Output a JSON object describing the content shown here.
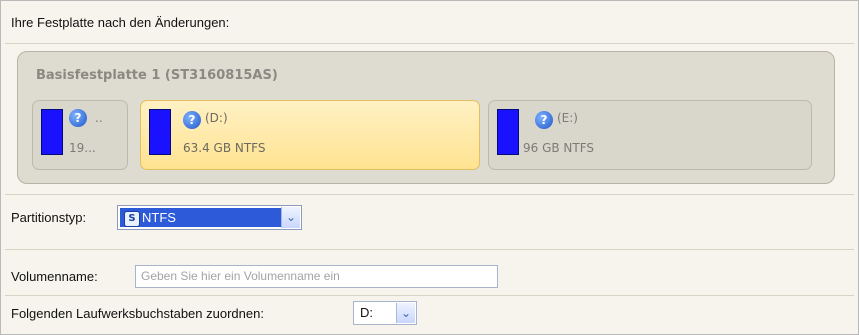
{
  "header": {
    "title": "Ihre Festplatte nach den Änderungen:"
  },
  "disk": {
    "title": "Basisfestplatte 1 (ST3160815AS)",
    "partitions": [
      {
        "name": "..",
        "size": "19...",
        "selected": false
      },
      {
        "name": "(D:)",
        "size": "63.4 GB NTFS",
        "selected": true
      },
      {
        "name": "(E:)",
        "size": "96 GB NTFS",
        "selected": false
      }
    ]
  },
  "form": {
    "partition_type": {
      "label": "Partitionstyp:",
      "value": "NTFS"
    },
    "volume_name": {
      "label": "Volumenname:",
      "placeholder": "Geben Sie hier ein Volumenname ein"
    },
    "drive_letter": {
      "label": "Folgenden Laufwerksbuchstaben zuordnen:",
      "value": "D:"
    }
  },
  "icons": {
    "help": "help-question-icon",
    "dropdown": "chevron-down-icon",
    "filesystem": "ntfs-filesystem-icon"
  },
  "colors": {
    "partition_bar": "#1a12ff",
    "selected_partition": "#ffe391",
    "combo_selection": "#2d5ad9"
  }
}
